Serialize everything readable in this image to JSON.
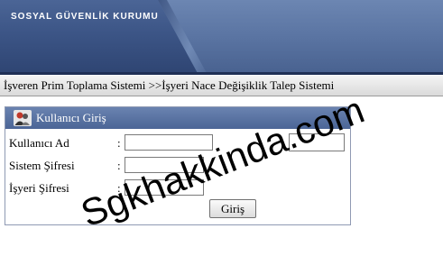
{
  "header": {
    "org_title": "SOSYAL GÜVENLİK KURUMU"
  },
  "breadcrumb": {
    "text": "İşveren Prim Toplama Sistemi >>İşyeri Nace Değişiklik Talep Sistemi"
  },
  "login": {
    "title": "Kullanıcı Giriş",
    "icon": "user-icon",
    "fields": [
      {
        "label": "Kullanıcı Ad",
        "colon": ":",
        "value": ""
      },
      {
        "label": "Sistem Şifresi",
        "colon": ":",
        "value": ""
      },
      {
        "label": "İşyeri Şifresi",
        "colon": ":",
        "value": ""
      }
    ],
    "submit_label": "Giriş"
  },
  "watermark": {
    "text": "Sgkhakkinda.com"
  },
  "colors": {
    "banner": "#3c5586",
    "panel_header": "#4b6596",
    "breadcrumb_bg": "#e6e6e6"
  }
}
